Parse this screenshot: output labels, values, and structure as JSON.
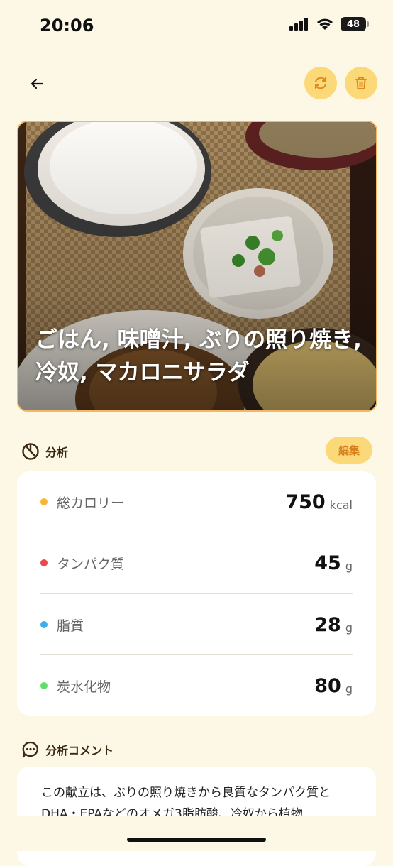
{
  "status_bar": {
    "time": "20:06",
    "battery": "48"
  },
  "nav": {
    "back_icon": "arrow-left-icon",
    "refresh_icon": "refresh-icon",
    "delete_icon": "trash-icon"
  },
  "meal": {
    "title": "ごはん, 味噌汁, ぶりの照り焼き, 冷奴, マカロニサラダ"
  },
  "analysis": {
    "title": "分析",
    "edit_label": "編集",
    "items": [
      {
        "label": "総カロリー",
        "value": "750",
        "unit": "kcal",
        "color": "#f7b733"
      },
      {
        "label": "タンパク質",
        "value": "45",
        "unit": "g",
        "color": "#ec4a4a"
      },
      {
        "label": "脂質",
        "value": "28",
        "unit": "g",
        "color": "#3aaee8"
      },
      {
        "label": "炭水化物",
        "value": "80",
        "unit": "g",
        "color": "#5fde6b"
      }
    ]
  },
  "comment": {
    "title": "分析コメント",
    "text": "この献立は、ぶりの照り焼きから良質なタンパク質とDHA・EPAなどのオメガ3脂肪酸、冷奴から植物"
  },
  "colors": {
    "background": "#fdf7e6",
    "accent": "#fbd978",
    "accent_text": "#d9801d",
    "photo_border": "#f3b865"
  }
}
